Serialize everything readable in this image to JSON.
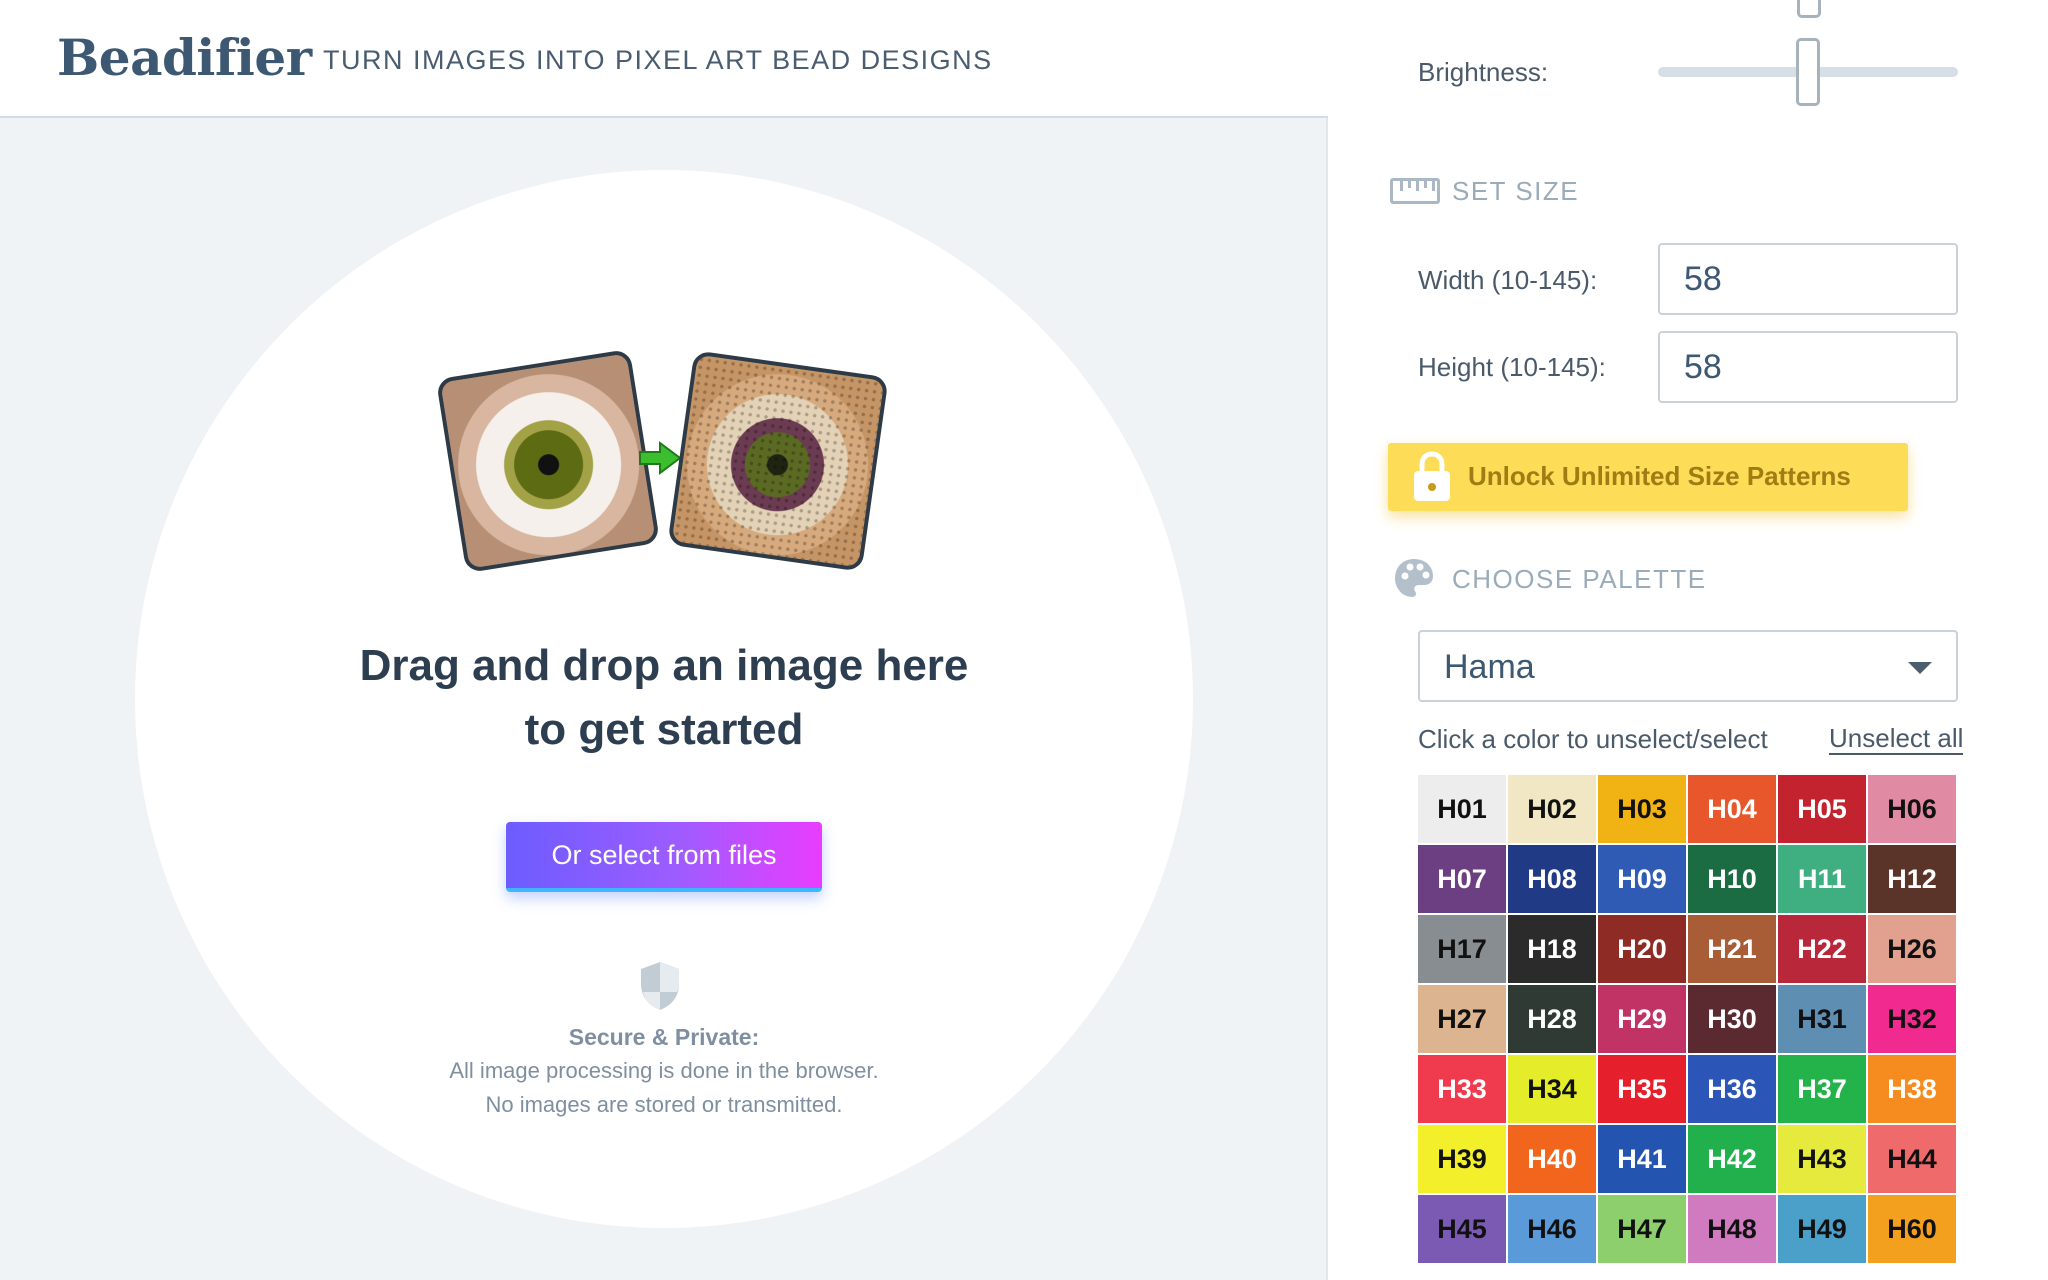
{
  "header": {
    "logo": "Beadifier",
    "tagline": "TURN IMAGES INTO PIXEL ART BEAD DESIGNS"
  },
  "dropzone": {
    "line1": "Drag and drop an image here",
    "line2": "to get started",
    "select_button": "Or select from files",
    "secure_title": "Secure & Private:",
    "secure_line1": "All image processing is done in the browser.",
    "secure_line2": "No images are stored or transmitted."
  },
  "settings": {
    "brightness_label": "Brightness:",
    "brightness_level": 0.5,
    "set_size_title": "SET SIZE",
    "width_label": "Width (10-145):",
    "width_value": "58",
    "height_label": "Height (10-145):",
    "height_value": "58",
    "unlock_label": "Unlock Unlimited Size Patterns",
    "palette_title": "CHOOSE PALETTE",
    "palette_selected": "Hama",
    "click_hint": "Click a color to unselect/select",
    "unselect_all": "Unselect all"
  },
  "colors": {
    "accent_gradient_start": "#6d5cff",
    "accent_gradient_end": "#e93cff",
    "unlock_yellow": "#fddc57"
  },
  "palette": [
    {
      "code": "H01",
      "bg": "#ecedec",
      "fg": "#111111"
    },
    {
      "code": "H02",
      "bg": "#f1e7c5",
      "fg": "#111111"
    },
    {
      "code": "H03",
      "bg": "#f1b214",
      "fg": "#111111"
    },
    {
      "code": "H04",
      "bg": "#e8562c",
      "fg": "#ffffff"
    },
    {
      "code": "H05",
      "bg": "#c3232f",
      "fg": "#ffffff"
    },
    {
      "code": "H06",
      "bg": "#e18aa3",
      "fg": "#111111"
    },
    {
      "code": "H07",
      "bg": "#6b3f82",
      "fg": "#ffffff"
    },
    {
      "code": "H08",
      "bg": "#213a86",
      "fg": "#ffffff"
    },
    {
      "code": "H09",
      "bg": "#2f5bb4",
      "fg": "#ffffff"
    },
    {
      "code": "H10",
      "bg": "#1b6b43",
      "fg": "#ffffff"
    },
    {
      "code": "H11",
      "bg": "#3fae80",
      "fg": "#ffffff"
    },
    {
      "code": "H12",
      "bg": "#5a3428",
      "fg": "#ffffff"
    },
    {
      "code": "H17",
      "bg": "#878d90",
      "fg": "#111111"
    },
    {
      "code": "H18",
      "bg": "#2b2b2b",
      "fg": "#ffffff"
    },
    {
      "code": "H20",
      "bg": "#8e2b25",
      "fg": "#ffffff"
    },
    {
      "code": "H21",
      "bg": "#a95d37",
      "fg": "#ffffff"
    },
    {
      "code": "H22",
      "bg": "#b8283a",
      "fg": "#ffffff"
    },
    {
      "code": "H26",
      "bg": "#e1a18e",
      "fg": "#111111"
    },
    {
      "code": "H27",
      "bg": "#dcb48f",
      "fg": "#111111"
    },
    {
      "code": "H28",
      "bg": "#2f3a35",
      "fg": "#ffffff"
    },
    {
      "code": "H29",
      "bg": "#c03364",
      "fg": "#ffffff"
    },
    {
      "code": "H30",
      "bg": "#5a2a30",
      "fg": "#ffffff"
    },
    {
      "code": "H31",
      "bg": "#5e8fb2",
      "fg": "#111111"
    },
    {
      "code": "H32",
      "bg": "#f02a8e",
      "fg": "#111111"
    },
    {
      "code": "H33",
      "bg": "#f03a4e",
      "fg": "#ffffff"
    },
    {
      "code": "H34",
      "bg": "#e5ec2a",
      "fg": "#111111"
    },
    {
      "code": "H35",
      "bg": "#e5202c",
      "fg": "#ffffff"
    },
    {
      "code": "H36",
      "bg": "#2b55b6",
      "fg": "#ffffff"
    },
    {
      "code": "H37",
      "bg": "#23b34a",
      "fg": "#ffffff"
    },
    {
      "code": "H38",
      "bg": "#f68c1f",
      "fg": "#ffffff"
    },
    {
      "code": "H39",
      "bg": "#f3ef2a",
      "fg": "#111111"
    },
    {
      "code": "H40",
      "bg": "#f2651d",
      "fg": "#ffffff"
    },
    {
      "code": "H41",
      "bg": "#2354b0",
      "fg": "#ffffff"
    },
    {
      "code": "H42",
      "bg": "#21b04c",
      "fg": "#ffffff"
    },
    {
      "code": "H43",
      "bg": "#e6ea3c",
      "fg": "#111111"
    },
    {
      "code": "H44",
      "bg": "#ef6a6a",
      "fg": "#111111"
    },
    {
      "code": "H45",
      "bg": "#7a5ab2",
      "fg": "#111111"
    },
    {
      "code": "H46",
      "bg": "#5a9ad8",
      "fg": "#111111"
    },
    {
      "code": "H47",
      "bg": "#8ccf6c",
      "fg": "#111111"
    },
    {
      "code": "H48",
      "bg": "#d07ac0",
      "fg": "#111111"
    },
    {
      "code": "H49",
      "bg": "#4aa0c8",
      "fg": "#111111"
    },
    {
      "code": "H60",
      "bg": "#f2a01e",
      "fg": "#111111"
    }
  ]
}
